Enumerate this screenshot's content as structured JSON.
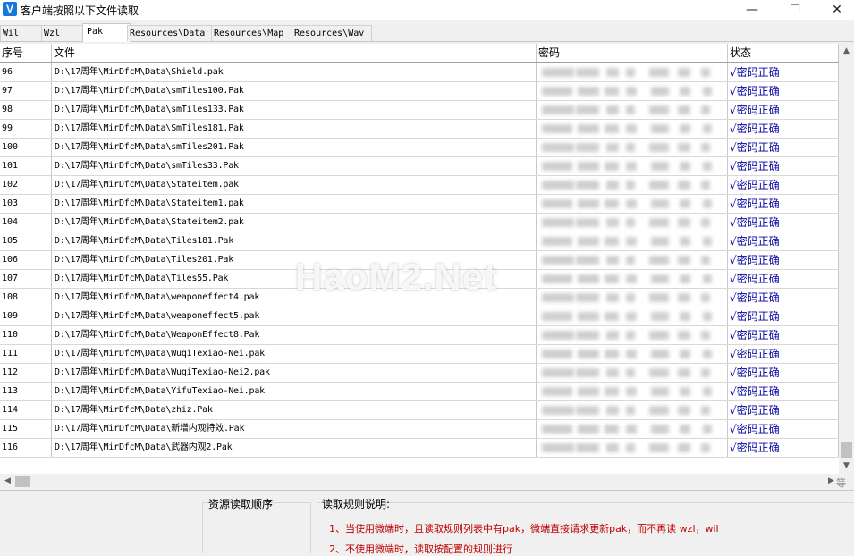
{
  "window": {
    "title": "客户端按照以下文件读取",
    "app_icon": "V",
    "controls": {
      "minimize": "—",
      "maximize": "☐",
      "close": "✕"
    }
  },
  "tabs": [
    {
      "label": "Wil",
      "active": false
    },
    {
      "label": "Wzl",
      "active": false
    },
    {
      "label": "Pak",
      "active": true
    },
    {
      "label": "Resources\\Data",
      "active": false
    },
    {
      "label": "Resources\\Map",
      "active": false
    },
    {
      "label": "Resources\\Wav",
      "active": false
    }
  ],
  "table": {
    "columns": {
      "index": "序号",
      "file": "文件",
      "password": "密码",
      "status": "状态"
    },
    "rows": [
      {
        "index": "96",
        "file": "D:\\17周年\\MirDfcM\\Data\\Shield.pak",
        "status": "√密码正确"
      },
      {
        "index": "97",
        "file": "D:\\17周年\\MirDfcM\\Data\\smTiles100.Pak",
        "status": "√密码正确"
      },
      {
        "index": "98",
        "file": "D:\\17周年\\MirDfcM\\Data\\smTiles133.Pak",
        "status": "√密码正确"
      },
      {
        "index": "99",
        "file": "D:\\17周年\\MirDfcM\\Data\\SmTiles181.Pak",
        "status": "√密码正确"
      },
      {
        "index": "100",
        "file": "D:\\17周年\\MirDfcM\\Data\\smTiles201.Pak",
        "status": "√密码正确"
      },
      {
        "index": "101",
        "file": "D:\\17周年\\MirDfcM\\Data\\smTiles33.Pak",
        "status": "√密码正确"
      },
      {
        "index": "102",
        "file": "D:\\17周年\\MirDfcM\\Data\\Stateitem.pak",
        "status": "√密码正确"
      },
      {
        "index": "103",
        "file": "D:\\17周年\\MirDfcM\\Data\\Stateitem1.pak",
        "status": "√密码正确"
      },
      {
        "index": "104",
        "file": "D:\\17周年\\MirDfcM\\Data\\Stateitem2.pak",
        "status": "√密码正确"
      },
      {
        "index": "105",
        "file": "D:\\17周年\\MirDfcM\\Data\\Tiles181.Pak",
        "status": "√密码正确"
      },
      {
        "index": "106",
        "file": "D:\\17周年\\MirDfcM\\Data\\Tiles201.Pak",
        "status": "√密码正确"
      },
      {
        "index": "107",
        "file": "D:\\17周年\\MirDfcM\\Data\\Tiles55.Pak",
        "status": "√密码正确"
      },
      {
        "index": "108",
        "file": "D:\\17周年\\MirDfcM\\Data\\weaponeffect4.pak",
        "status": "√密码正确"
      },
      {
        "index": "109",
        "file": "D:\\17周年\\MirDfcM\\Data\\weaponeffect5.pak",
        "status": "√密码正确"
      },
      {
        "index": "110",
        "file": "D:\\17周年\\MirDfcM\\Data\\WeaponEffect8.Pak",
        "status": "√密码正确"
      },
      {
        "index": "111",
        "file": "D:\\17周年\\MirDfcM\\Data\\WuqiTexiao-Nei.pak",
        "status": "√密码正确"
      },
      {
        "index": "112",
        "file": "D:\\17周年\\MirDfcM\\Data\\WuqiTexiao-Nei2.pak",
        "status": "√密码正确"
      },
      {
        "index": "113",
        "file": "D:\\17周年\\MirDfcM\\Data\\YifuTexiao-Nei.pak",
        "status": "√密码正确"
      },
      {
        "index": "114",
        "file": "D:\\17周年\\MirDfcM\\Data\\zhiz.Pak",
        "status": "√密码正确"
      },
      {
        "index": "115",
        "file": "D:\\17周年\\MirDfcM\\Data\\新增内观特效.Pak",
        "status": "√密码正确"
      },
      {
        "index": "116",
        "file": "D:\\17周年\\MirDfcM\\Data\\武器内观2.Pak",
        "status": "√密码正确"
      }
    ]
  },
  "scrollbar": {
    "corner_text": "等"
  },
  "bottom": {
    "order_label": "资源读取顺序",
    "rules_label": "读取规则说明:",
    "rules": [
      "1、当使用微端时，且读取规则列表中有pak，微端直接请求更新pak，而不再读 wzl，wil",
      "2、不使用微端时，读取按配置的规则进行"
    ]
  },
  "watermark": "HaoM2.Net",
  "colors": {
    "status_text": "#0000a0",
    "rule_text": "#c00000",
    "app_icon_bg": "#1479d8"
  }
}
